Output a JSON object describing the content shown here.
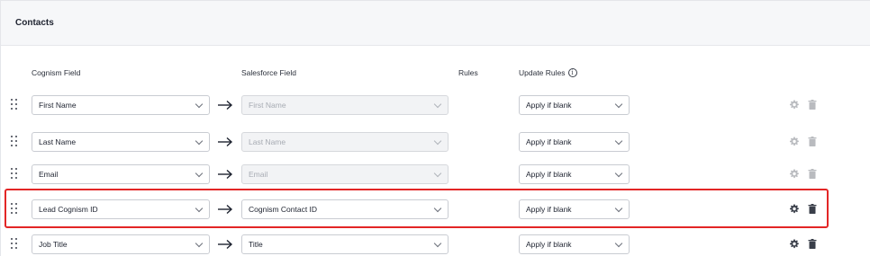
{
  "section": {
    "title": "Contacts"
  },
  "columns": {
    "cognism_field": "Cognism Field",
    "salesforce_field": "Salesforce Field",
    "rules": "Rules",
    "update_rules": "Update Rules",
    "update_rules_info": "i"
  },
  "rows": [
    {
      "cognism": "First Name",
      "salesforce": "First Name",
      "salesforce_disabled": true,
      "update_rule": "Apply if blank",
      "actions_enabled": false
    },
    {
      "cognism": "Last Name",
      "salesforce": "Last Name",
      "salesforce_disabled": true,
      "update_rule": "Apply if blank",
      "actions_enabled": false
    },
    {
      "cognism": "Email",
      "salesforce": "Email",
      "salesforce_disabled": true,
      "update_rule": "Apply if blank",
      "actions_enabled": false
    },
    {
      "cognism": "Lead Cognism ID",
      "salesforce": "Cognism Contact ID",
      "salesforce_disabled": false,
      "update_rule": "Apply if blank",
      "actions_enabled": true,
      "highlighted": true
    },
    {
      "cognism": "Job Title",
      "salesforce": "Title",
      "salesforce_disabled": false,
      "update_rule": "Apply if blank",
      "actions_enabled": true
    }
  ],
  "colors": {
    "highlight": "#e32626",
    "accent_text": "#1e2330"
  }
}
